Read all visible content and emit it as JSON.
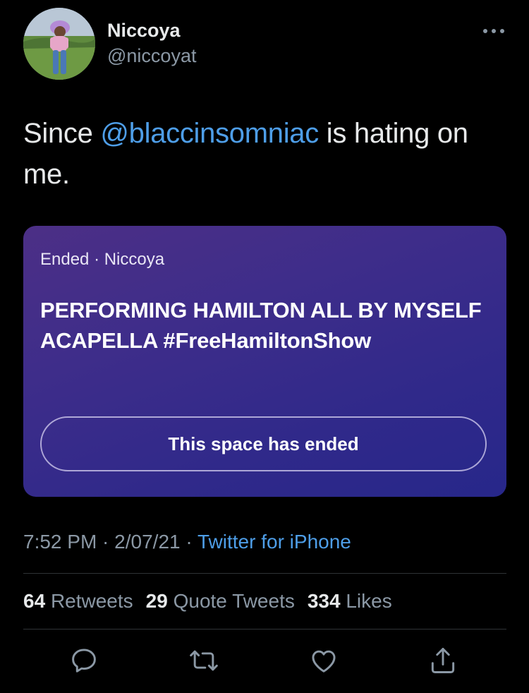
{
  "author": {
    "name": "Niccoya",
    "handle": "@niccoyat"
  },
  "tweet": {
    "text_before": "Since ",
    "mention": "@blaccinsomniac",
    "text_after": " is hating on me."
  },
  "space": {
    "status": "Ended · Niccoya",
    "title": "PERFORMING HAMILTON ALL BY MYSELF ACAPELLA #FreeHamiltonShow",
    "button_label": "This space has ended"
  },
  "meta": {
    "time": "7:52 PM",
    "separator1": " · ",
    "date": "2/07/21",
    "separator2": " · ",
    "source": "Twitter for iPhone"
  },
  "stats": {
    "retweets_count": "64",
    "retweets_label": "Retweets",
    "quotes_count": "29",
    "quotes_label": "Quote Tweets",
    "likes_count": "334",
    "likes_label": "Likes"
  },
  "icons": {
    "more": "more-icon",
    "reply": "reply-icon",
    "retweet": "retweet-icon",
    "like": "like-icon",
    "share": "share-icon"
  },
  "colors": {
    "background": "#000000",
    "text_primary": "#e7e9ea",
    "text_secondary": "#8b98a5",
    "link": "#4e9ee8",
    "card_gradient_start": "#4c2f86",
    "card_gradient_end": "#27278a",
    "divider": "#2f3336"
  }
}
